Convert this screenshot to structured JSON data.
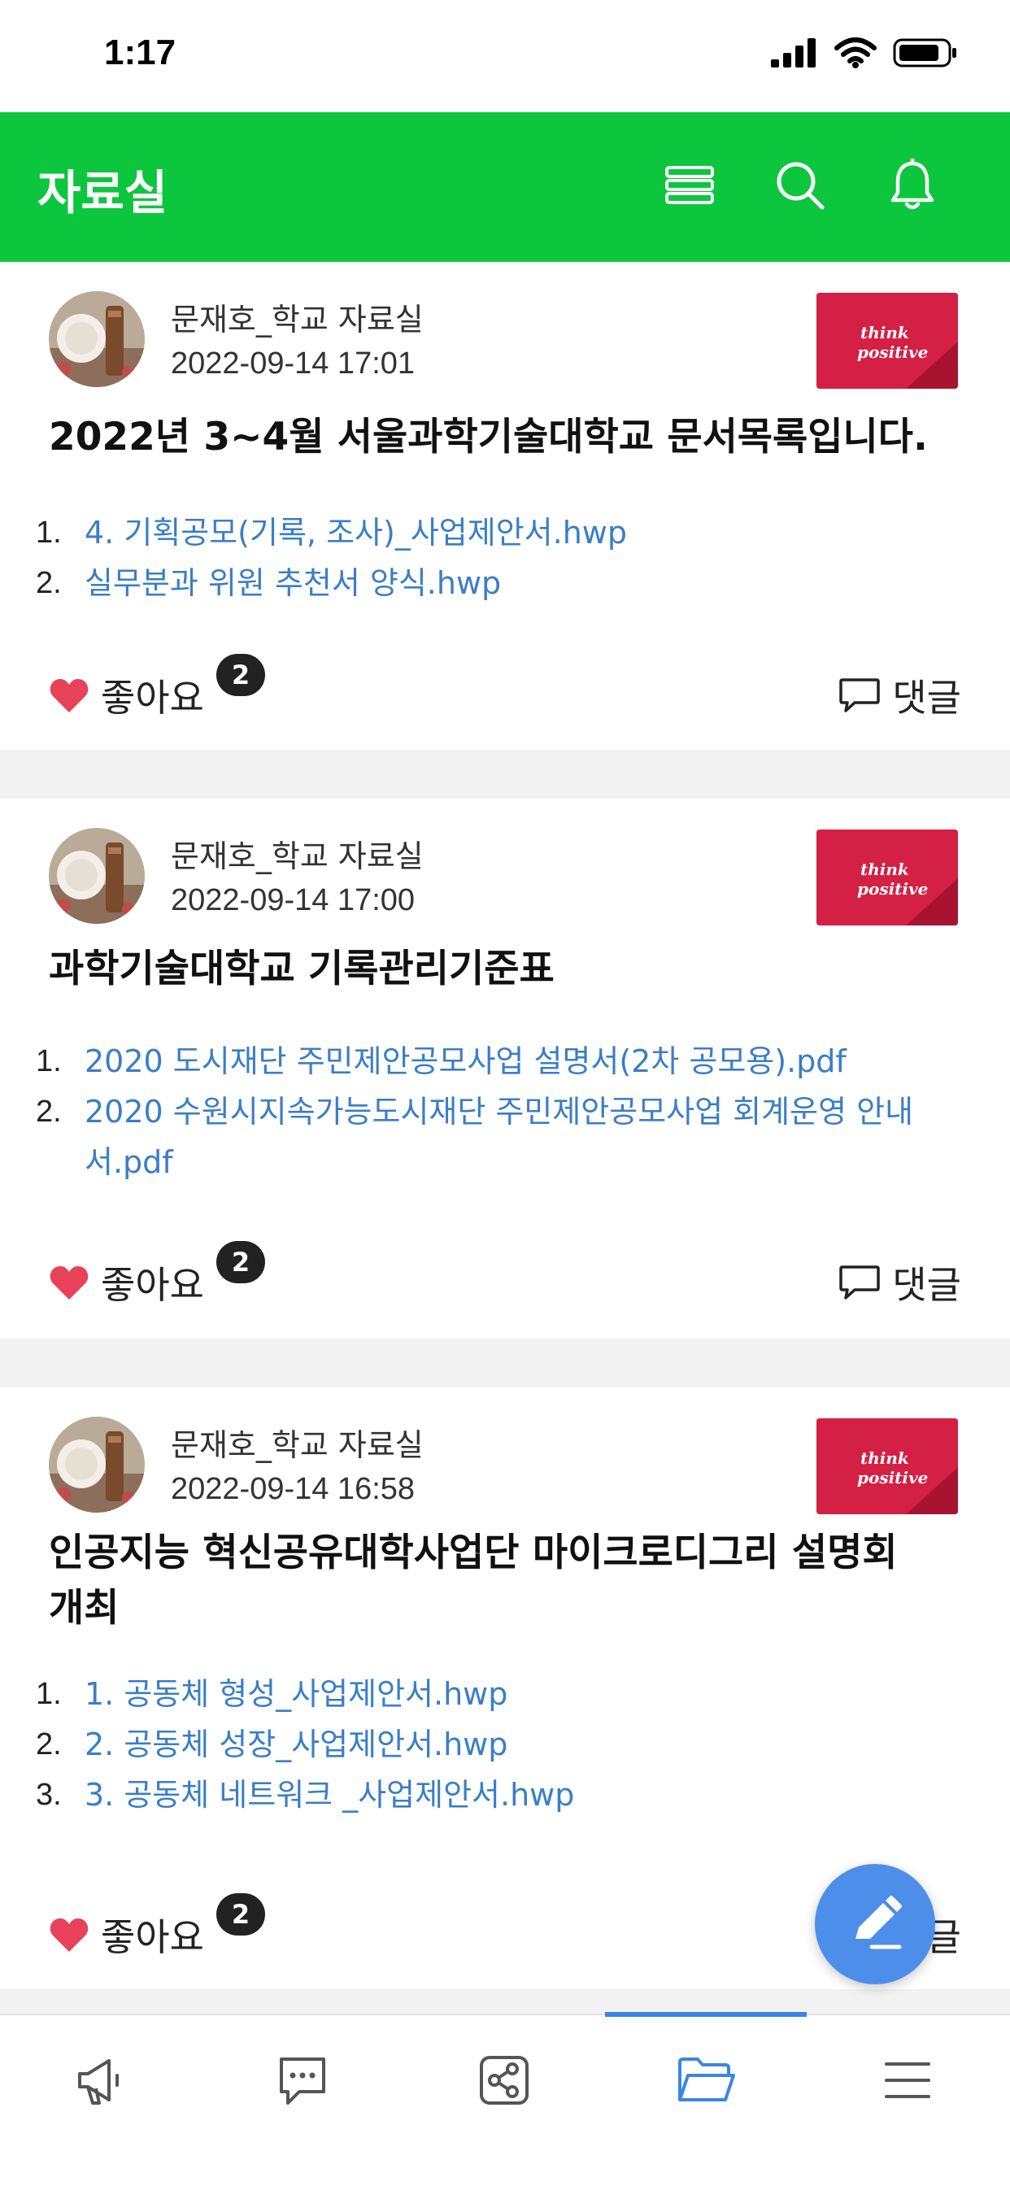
{
  "status_bar": {
    "time": "1:17"
  },
  "header": {
    "title": "자료실",
    "bg_color": "#0cc63e",
    "icons": [
      "list-icon",
      "search-icon",
      "bell-icon"
    ]
  },
  "posts": [
    {
      "author": "문재호_학교 자료실",
      "date": "2022-09-14 17:01",
      "title_lines": [
        "2022년 3~4월 서울과학기술대학교 문서목록입니다."
      ],
      "files": [
        {
          "num": "1.",
          "lines": [
            "4. 기획공모(기록, 조사)_사업제안서.hwp"
          ]
        },
        {
          "num": "2.",
          "lines": [
            "실무분과 위원 추천서 양식.hwp"
          ]
        }
      ],
      "like_label": "좋아요",
      "like_count": "2",
      "comment_label": "댓글"
    },
    {
      "author": "문재호_학교 자료실",
      "date": "2022-09-14 17:00",
      "title_lines": [
        "과학기술대학교 기록관리기준표"
      ],
      "files": [
        {
          "num": "1.",
          "lines": [
            "2020 도시재단 주민제안공모사업 설명서(2차 공모용).pdf"
          ]
        },
        {
          "num": "2.",
          "lines": [
            "2020 수원시지속가능도시재단 주민제안공모사업 회계운영 안내",
            "서.pdf"
          ]
        }
      ],
      "like_label": "좋아요",
      "like_count": "2",
      "comment_label": "댓글"
    },
    {
      "author": "문재호_학교 자료실",
      "date": "2022-09-14 16:58",
      "title_lines": [
        "인공지능 혁신공유대학사업단 마이크로디그리 설명회",
        "개최"
      ],
      "files": [
        {
          "num": "1.",
          "lines": [
            "1. 공동체 형성_사업제안서.hwp"
          ]
        },
        {
          "num": "2.",
          "lines": [
            "2. 공동체 성장_사업제안서.hwp"
          ]
        },
        {
          "num": "3.",
          "lines": [
            "3. 공동체 네트워크 _사업제안서.hwp"
          ]
        }
      ],
      "like_label": "좋아요",
      "like_count": "2",
      "comment_label": "댓글"
    }
  ],
  "tab_bar": {
    "tabs": [
      "megaphone-icon",
      "chat-icon",
      "share-icon",
      "folder-icon",
      "menu-icon"
    ],
    "active": "folder-icon",
    "accent": "#3a86e3"
  },
  "fab": {
    "icon": "pencil-icon",
    "color": "#4e8eeb"
  },
  "colors": {
    "link": "#3a7ec6",
    "heart": "#e8415a",
    "thumb": "#d42044"
  }
}
